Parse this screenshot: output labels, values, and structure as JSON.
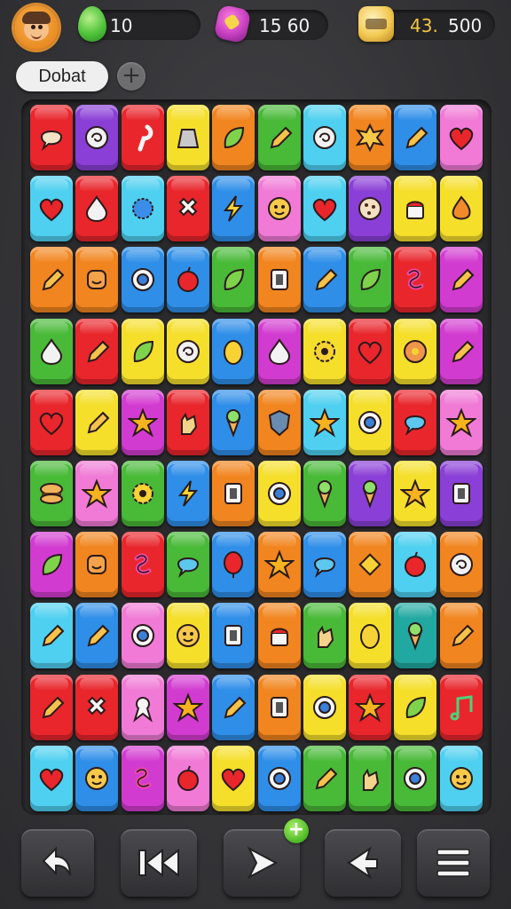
{
  "hud": {
    "gems": "10",
    "moves": "15 60",
    "coins": "43.",
    "coins_suffix": "500"
  },
  "mode_label": "Dobat",
  "colors": {
    "red": "#e8262c",
    "purple": "#8a3fd6",
    "yellow": "#f5df2b",
    "orange": "#f1851f",
    "green": "#49b938",
    "cyan": "#4fd0f0",
    "blue": "#2f8ee8",
    "pink": "#f07ad6",
    "magenta": "#d23bd0",
    "teal": "#21a8a0"
  },
  "board": {
    "rows": [
      [
        [
          "red",
          "chat-bubble"
        ],
        [
          "purple",
          "swirl"
        ],
        [
          "red",
          "hook"
        ],
        [
          "yellow",
          "gray-block"
        ],
        [
          "orange",
          "leaf"
        ],
        [
          "green",
          "pencil"
        ],
        [
          "cyan",
          "swirl"
        ],
        [
          "orange",
          "star-splat"
        ],
        [
          "blue",
          "pencil"
        ],
        [
          "pink",
          "heart"
        ]
      ],
      [
        [
          "cyan",
          "heart"
        ],
        [
          "red",
          "drop"
        ],
        [
          "cyan",
          "sun"
        ],
        [
          "red",
          "cross"
        ],
        [
          "blue",
          "bolt"
        ],
        [
          "pink",
          "face"
        ],
        [
          "cyan",
          "heart"
        ],
        [
          "purple",
          "cookie"
        ],
        [
          "yellow",
          "cake"
        ],
        [
          "yellow",
          "flame"
        ]
      ],
      [
        [
          "orange",
          "pencil"
        ],
        [
          "orange",
          "smile"
        ],
        [
          "blue",
          "ring"
        ],
        [
          "blue",
          "apple"
        ],
        [
          "green",
          "leaf"
        ],
        [
          "orange",
          "block"
        ],
        [
          "blue",
          "pencil"
        ],
        [
          "green",
          "leaf"
        ],
        [
          "red",
          "squiggle"
        ],
        [
          "magenta",
          "pencil"
        ]
      ],
      [
        [
          "green",
          "drop"
        ],
        [
          "red",
          "pencil"
        ],
        [
          "yellow",
          "leaf"
        ],
        [
          "yellow",
          "swirl"
        ],
        [
          "blue",
          "egg"
        ],
        [
          "magenta",
          "drop"
        ],
        [
          "yellow",
          "gear"
        ],
        [
          "red",
          "heart"
        ],
        [
          "yellow",
          "flower"
        ],
        [
          "magenta",
          "pencil"
        ]
      ],
      [
        [
          "red",
          "heart"
        ],
        [
          "yellow",
          "pencil"
        ],
        [
          "magenta",
          "star"
        ],
        [
          "red",
          "hand"
        ],
        [
          "blue",
          "cone"
        ],
        [
          "orange",
          "shield"
        ],
        [
          "cyan",
          "star"
        ],
        [
          "yellow",
          "ring"
        ],
        [
          "red",
          "bubble"
        ],
        [
          "pink",
          "star"
        ]
      ],
      [
        [
          "green",
          "burger"
        ],
        [
          "pink",
          "star"
        ],
        [
          "green",
          "gear"
        ],
        [
          "blue",
          "bolt"
        ],
        [
          "orange",
          "block"
        ],
        [
          "yellow",
          "ring"
        ],
        [
          "green",
          "cone"
        ],
        [
          "purple",
          "cone"
        ],
        [
          "yellow",
          "star"
        ],
        [
          "purple",
          "block"
        ]
      ],
      [
        [
          "magenta",
          "leaf"
        ],
        [
          "orange",
          "smile"
        ],
        [
          "red",
          "squiggle"
        ],
        [
          "green",
          "bubble"
        ],
        [
          "blue",
          "balloon"
        ],
        [
          "orange",
          "star"
        ],
        [
          "blue",
          "bubble"
        ],
        [
          "orange",
          "diamond"
        ],
        [
          "cyan",
          "apple"
        ],
        [
          "orange",
          "swirl"
        ]
      ],
      [
        [
          "cyan",
          "pencil"
        ],
        [
          "blue",
          "pencil"
        ],
        [
          "pink",
          "ring"
        ],
        [
          "yellow",
          "face"
        ],
        [
          "blue",
          "block"
        ],
        [
          "orange",
          "cake"
        ],
        [
          "green",
          "hand"
        ],
        [
          "yellow",
          "egg"
        ],
        [
          "teal",
          "cone"
        ],
        [
          "orange",
          "pencil"
        ]
      ],
      [
        [
          "red",
          "pencil"
        ],
        [
          "red",
          "cross"
        ],
        [
          "pink",
          "ribbon"
        ],
        [
          "magenta",
          "star"
        ],
        [
          "blue",
          "pencil"
        ],
        [
          "orange",
          "block"
        ],
        [
          "yellow",
          "ring"
        ],
        [
          "red",
          "star"
        ],
        [
          "yellow",
          "leaf"
        ],
        [
          "red",
          "music"
        ]
      ],
      [
        [
          "cyan",
          "heart"
        ],
        [
          "blue",
          "face"
        ],
        [
          "magenta",
          "squiggle"
        ],
        [
          "pink",
          "apple"
        ],
        [
          "yellow",
          "heart"
        ],
        [
          "blue",
          "ring"
        ],
        [
          "green",
          "pencil"
        ],
        [
          "green",
          "hand"
        ],
        [
          "green",
          "ring"
        ],
        [
          "cyan",
          "face"
        ]
      ]
    ]
  },
  "buttons": [
    "undo-icon",
    "rewind-icon",
    "play-icon",
    "back-arrow-icon",
    "menu-icon"
  ]
}
